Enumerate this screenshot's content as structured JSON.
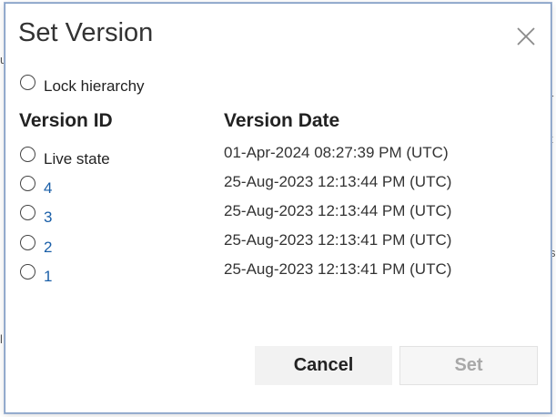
{
  "background": {
    "fragments": [
      "u",
      "r",
      "t",
      "s",
      "l"
    ]
  },
  "dialog": {
    "title": "Set Version",
    "close_icon": "close-icon",
    "lock_hierarchy_label": "Lock hierarchy",
    "columns": {
      "version_id": "Version ID",
      "version_date": "Version Date"
    },
    "rows": [
      {
        "id": "Live state",
        "date": "01-Apr-2024 08:27:39 PM (UTC)"
      },
      {
        "id": "4",
        "date": "25-Aug-2023 12:13:44 PM (UTC)"
      },
      {
        "id": "3",
        "date": "25-Aug-2023 12:13:44 PM (UTC)"
      },
      {
        "id": "2",
        "date": "25-Aug-2023 12:13:41 PM (UTC)"
      },
      {
        "id": "1",
        "date": "25-Aug-2023 12:13:41 PM (UTC)"
      }
    ],
    "buttons": {
      "cancel": "Cancel",
      "set": "Set"
    }
  }
}
